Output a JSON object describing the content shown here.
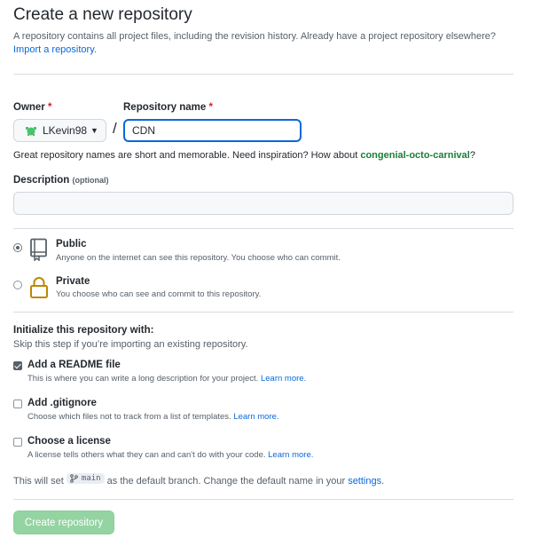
{
  "header": {
    "title": "Create a new repository",
    "subtitle": "A repository contains all project files, including the revision history. Already have a project repository elsewhere?",
    "import_link": "Import a repository."
  },
  "form": {
    "owner_label": "Owner",
    "owner_required": "*",
    "owner_value": "LKevin98",
    "separator": "/",
    "repo_label": "Repository name",
    "repo_required": "*",
    "repo_value": "CDN",
    "suggestion_text": "Great repository names are short and memorable. Need inspiration? How about",
    "suggestion_name": "congenial-octo-carnival",
    "suggestion_end": "?",
    "description_label": "Description",
    "description_optional": "(optional)",
    "description_value": ""
  },
  "visibility": {
    "public_title": "Public",
    "public_desc": "Anyone on the internet can see this repository. You choose who can commit.",
    "public_selected": true,
    "private_title": "Private",
    "private_desc": "You choose who can see and commit to this repository.",
    "private_selected": false
  },
  "init": {
    "heading": "Initialize this repository with:",
    "subheading": "Skip this step if you’re importing an existing repository.",
    "readme_title": "Add a README file",
    "readme_desc": "This is where you can write a long description for your project.",
    "readme_checked": true,
    "gitignore_title": "Add .gitignore",
    "gitignore_desc": "Choose which files not to track from a list of templates.",
    "gitignore_checked": false,
    "license_title": "Choose a license",
    "license_desc": "A license tells others what they can and can't do with your code.",
    "license_checked": false,
    "learn_more": "Learn more."
  },
  "branch": {
    "prefix": "This will set",
    "branch_name": "main",
    "suffix": "as the default branch. Change the default name in your",
    "settings_link": "settings",
    "end": "."
  },
  "submit": {
    "label": "Create repository"
  },
  "colors": {
    "accent": "#0969da",
    "green": "#1a7f37",
    "button_disabled": "#94d3a2"
  }
}
